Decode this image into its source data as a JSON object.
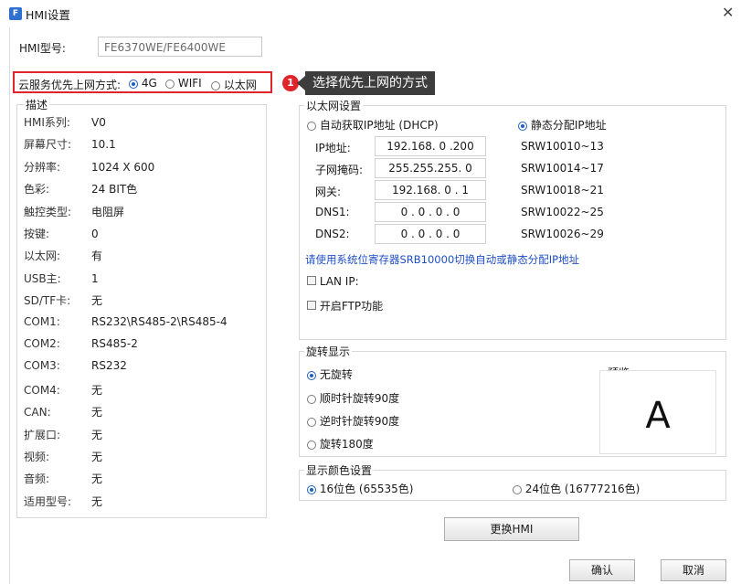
{
  "window": {
    "title": "HMI设置",
    "app_icon": "F"
  },
  "model": {
    "label": "HMI型号:",
    "value": "FE6370WE/FE6400WE"
  },
  "network": {
    "label": "云服务优先上网方式:",
    "options": [
      {
        "label": "4G",
        "selected": true
      },
      {
        "label": "WIFI",
        "selected": false
      },
      {
        "label": "以太网",
        "selected": false
      }
    ]
  },
  "callout": {
    "number": "1",
    "text": "选择优先上网的方式"
  },
  "description": {
    "title": "描述",
    "rows": [
      {
        "key": "HMI系列:",
        "value": "V0"
      },
      {
        "key": "屏幕尺寸:",
        "value": "10.1"
      },
      {
        "key": "分辨率:",
        "value": "1024 X 600"
      },
      {
        "key": "色彩:",
        "value": "24 BIT色"
      },
      {
        "key": "触控类型:",
        "value": "电阻屏"
      },
      {
        "key": "按键:",
        "value": "0"
      },
      {
        "key": "以太网:",
        "value": "有"
      },
      {
        "key": "USB主:",
        "value": "1"
      },
      {
        "key": "SD/TF卡:",
        "value": "无"
      },
      {
        "key": "COM1:",
        "value": "RS232\\RS485-2\\RS485-4"
      },
      {
        "key": "COM2:",
        "value": "RS485-2"
      },
      {
        "key": "COM3:",
        "value": "RS232"
      },
      {
        "key": "COM4:",
        "value": "无"
      },
      {
        "key": "CAN:",
        "value": "无"
      },
      {
        "key": "扩展口:",
        "value": "无"
      },
      {
        "key": "视频:",
        "value": "无"
      },
      {
        "key": "音频:",
        "value": "无"
      },
      {
        "key": "适用型号:",
        "value": "无"
      }
    ]
  },
  "ethernet": {
    "title": "以太网设置",
    "mode_dhcp": "自动获取IP地址 (DHCP)",
    "mode_static": "静态分配IP地址",
    "fields": [
      {
        "label": "IP地址:",
        "value": "192.168. 0 .200",
        "register": "SRW10010~13"
      },
      {
        "label": "子网掩码:",
        "value": "255.255.255. 0",
        "register": "SRW10014~17"
      },
      {
        "label": "网关:",
        "value": "192.168. 0 . 1",
        "register": "SRW10018~21"
      },
      {
        "label": "DNS1:",
        "value": "0 . 0 . 0 . 0",
        "register": "SRW10022~25"
      },
      {
        "label": "DNS2:",
        "value": "0 . 0 . 0 . 0",
        "register": "SRW10026~29"
      }
    ],
    "hint": "请使用系统位寄存器SRB10000切换自动或静态分配IP地址",
    "lan_ip": "LAN IP:",
    "ftp": "开启FTP功能"
  },
  "rotation": {
    "title": "旋转显示",
    "options": [
      "无旋转",
      "顺时针旋转90度",
      "逆时针旋转90度",
      "旋转180度"
    ],
    "preview_label": "预览",
    "preview_char": "A"
  },
  "color": {
    "title": "显示颜色设置",
    "option16": "16位色 (65535色)",
    "option24": "24位色 (16777216色)"
  },
  "buttons": {
    "change": "更换HMI",
    "ok": "确认",
    "cancel": "取消"
  },
  "colors": {
    "accent": "#1f5fbf",
    "highlight": "#e0242a",
    "callout_bg": "#3d3d3d",
    "hint": "#1f4fc8"
  }
}
